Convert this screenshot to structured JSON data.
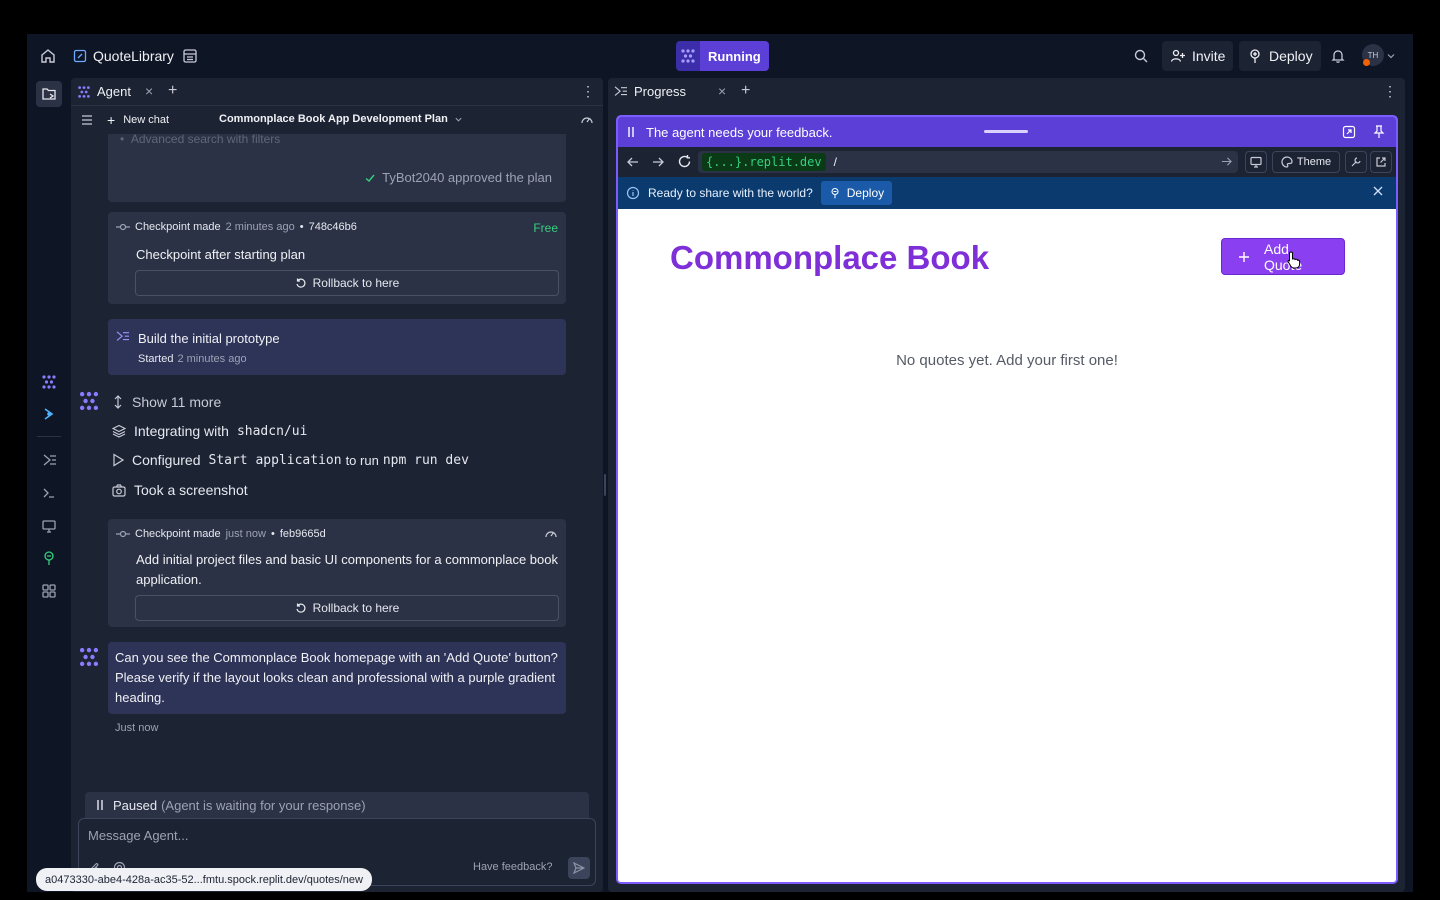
{
  "topbar": {
    "project_name": "QuoteLibrary",
    "run_status": "Running",
    "invite_label": "Invite",
    "deploy_label": "Deploy",
    "avatar_initials": "TH"
  },
  "left_panel": {
    "tab_label": "Agent",
    "new_chat_label": "New chat",
    "chat_title": "Commonplace Book App Development Plan",
    "faded_item": "Advanced search with filters",
    "approved_text": "TyBot2040 approved the plan",
    "checkpoint1": {
      "prefix": "Checkpoint made",
      "time": "2 minutes ago",
      "hash": "748c46b6",
      "badge": "Free",
      "title": "Checkpoint after starting plan",
      "rollback_label": "Rollback to here"
    },
    "progress_card": {
      "title": "Build the initial prototype",
      "started_prefix": "Started",
      "started_time": "2 minutes ago"
    },
    "actions": {
      "show_more": "Show 11 more",
      "integrating_prefix": "Integrating with",
      "integrating_code": "shadcn/ui",
      "configured_prefix": "Configured",
      "configured_code1": "Start application",
      "configured_mid": "to run",
      "configured_code2": "npm run dev",
      "screenshot": "Took a screenshot"
    },
    "checkpoint2": {
      "prefix": "Checkpoint made",
      "time": "just now",
      "hash": "feb9665d",
      "text": "Add initial project files and basic UI components for a commonplace book application.",
      "rollback_label": "Rollback to here"
    },
    "agent_message": {
      "text": "Can you see the Commonplace Book homepage with an 'Add Quote' button? Please verify if the layout looks clean and professional with a purple gradient heading.",
      "time": "Just now"
    },
    "paused_label": "Paused",
    "paused_detail": "(Agent is waiting for your response)",
    "composer_placeholder": "Message Agent...",
    "feedback_link": "Have feedback?"
  },
  "url_tooltip": "a0473330-abe4-428a-ac35-52...fmtu.spock.replit.dev/quotes/new",
  "right_panel": {
    "tab_label": "Progress",
    "feedback_bar": "The agent needs your feedback.",
    "url_host": "{...}.replit.dev",
    "url_path": "/",
    "theme_label": "Theme",
    "banner_text": "Ready to share with the world?",
    "banner_deploy": "Deploy",
    "app": {
      "heading": "Commonplace Book",
      "add_button": "Add Quote",
      "empty_text": "No quotes yet. Add your first one!"
    }
  },
  "colors": {
    "background": "#0e1525",
    "panel": "#1c2333",
    "card": "#2b3245",
    "accent_purple": "#5b3fd6",
    "heading_purple": "#7e2fd8",
    "free_green": "#35d07f"
  }
}
